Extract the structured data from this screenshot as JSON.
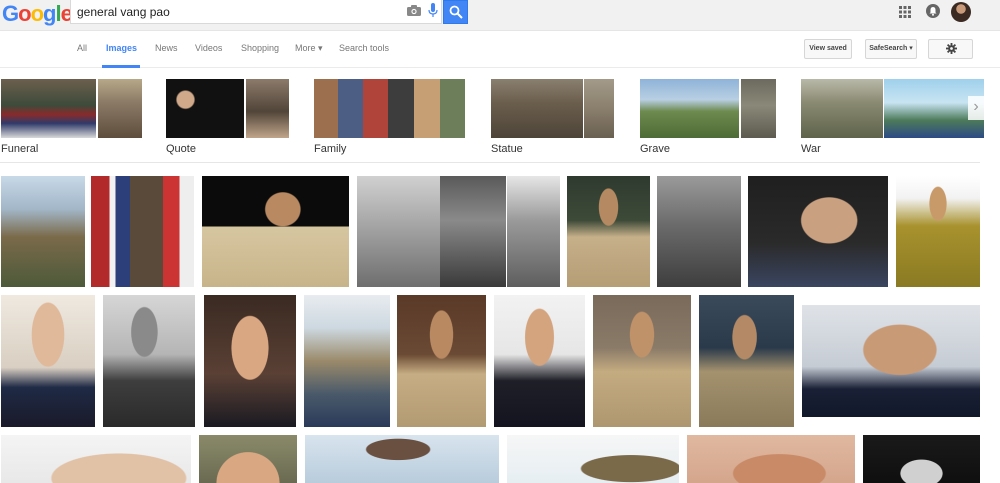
{
  "search": {
    "query": "general vang pao",
    "logo_letters": [
      {
        "ch": "G",
        "color": "#4285f4"
      },
      {
        "ch": "o",
        "color": "#ea4335"
      },
      {
        "ch": "o",
        "color": "#fbbc05"
      },
      {
        "ch": "g",
        "color": "#4285f4"
      },
      {
        "ch": "l",
        "color": "#34a853"
      },
      {
        "ch": "e",
        "color": "#ea4335"
      }
    ],
    "search_button_color": "#4285f4"
  },
  "icons": {
    "camera": "camera-icon",
    "mic": "microphone-icon",
    "search": "search-icon",
    "apps": "apps-grid-icon",
    "notifications": "notifications-icon",
    "settings": "gear-icon",
    "next": "chevron-right-icon"
  },
  "tabs": [
    {
      "label": "All"
    },
    {
      "label": "Images",
      "active": true
    },
    {
      "label": "News"
    },
    {
      "label": "Videos"
    },
    {
      "label": "Shopping"
    },
    {
      "label": "More ▾"
    },
    {
      "label": "Search tools"
    }
  ],
  "toolbar": {
    "view_saved": "View saved",
    "safesearch": "SafeSearch ▾"
  },
  "related": [
    {
      "label": "Funeral"
    },
    {
      "label": "Quote"
    },
    {
      "label": "Family"
    },
    {
      "label": "Statue"
    },
    {
      "label": "Grave"
    },
    {
      "label": "War"
    }
  ],
  "palette": {
    "accent": "#4285f4",
    "tab_inactive": "#777777",
    "header_bg": "#f1f1f1"
  }
}
